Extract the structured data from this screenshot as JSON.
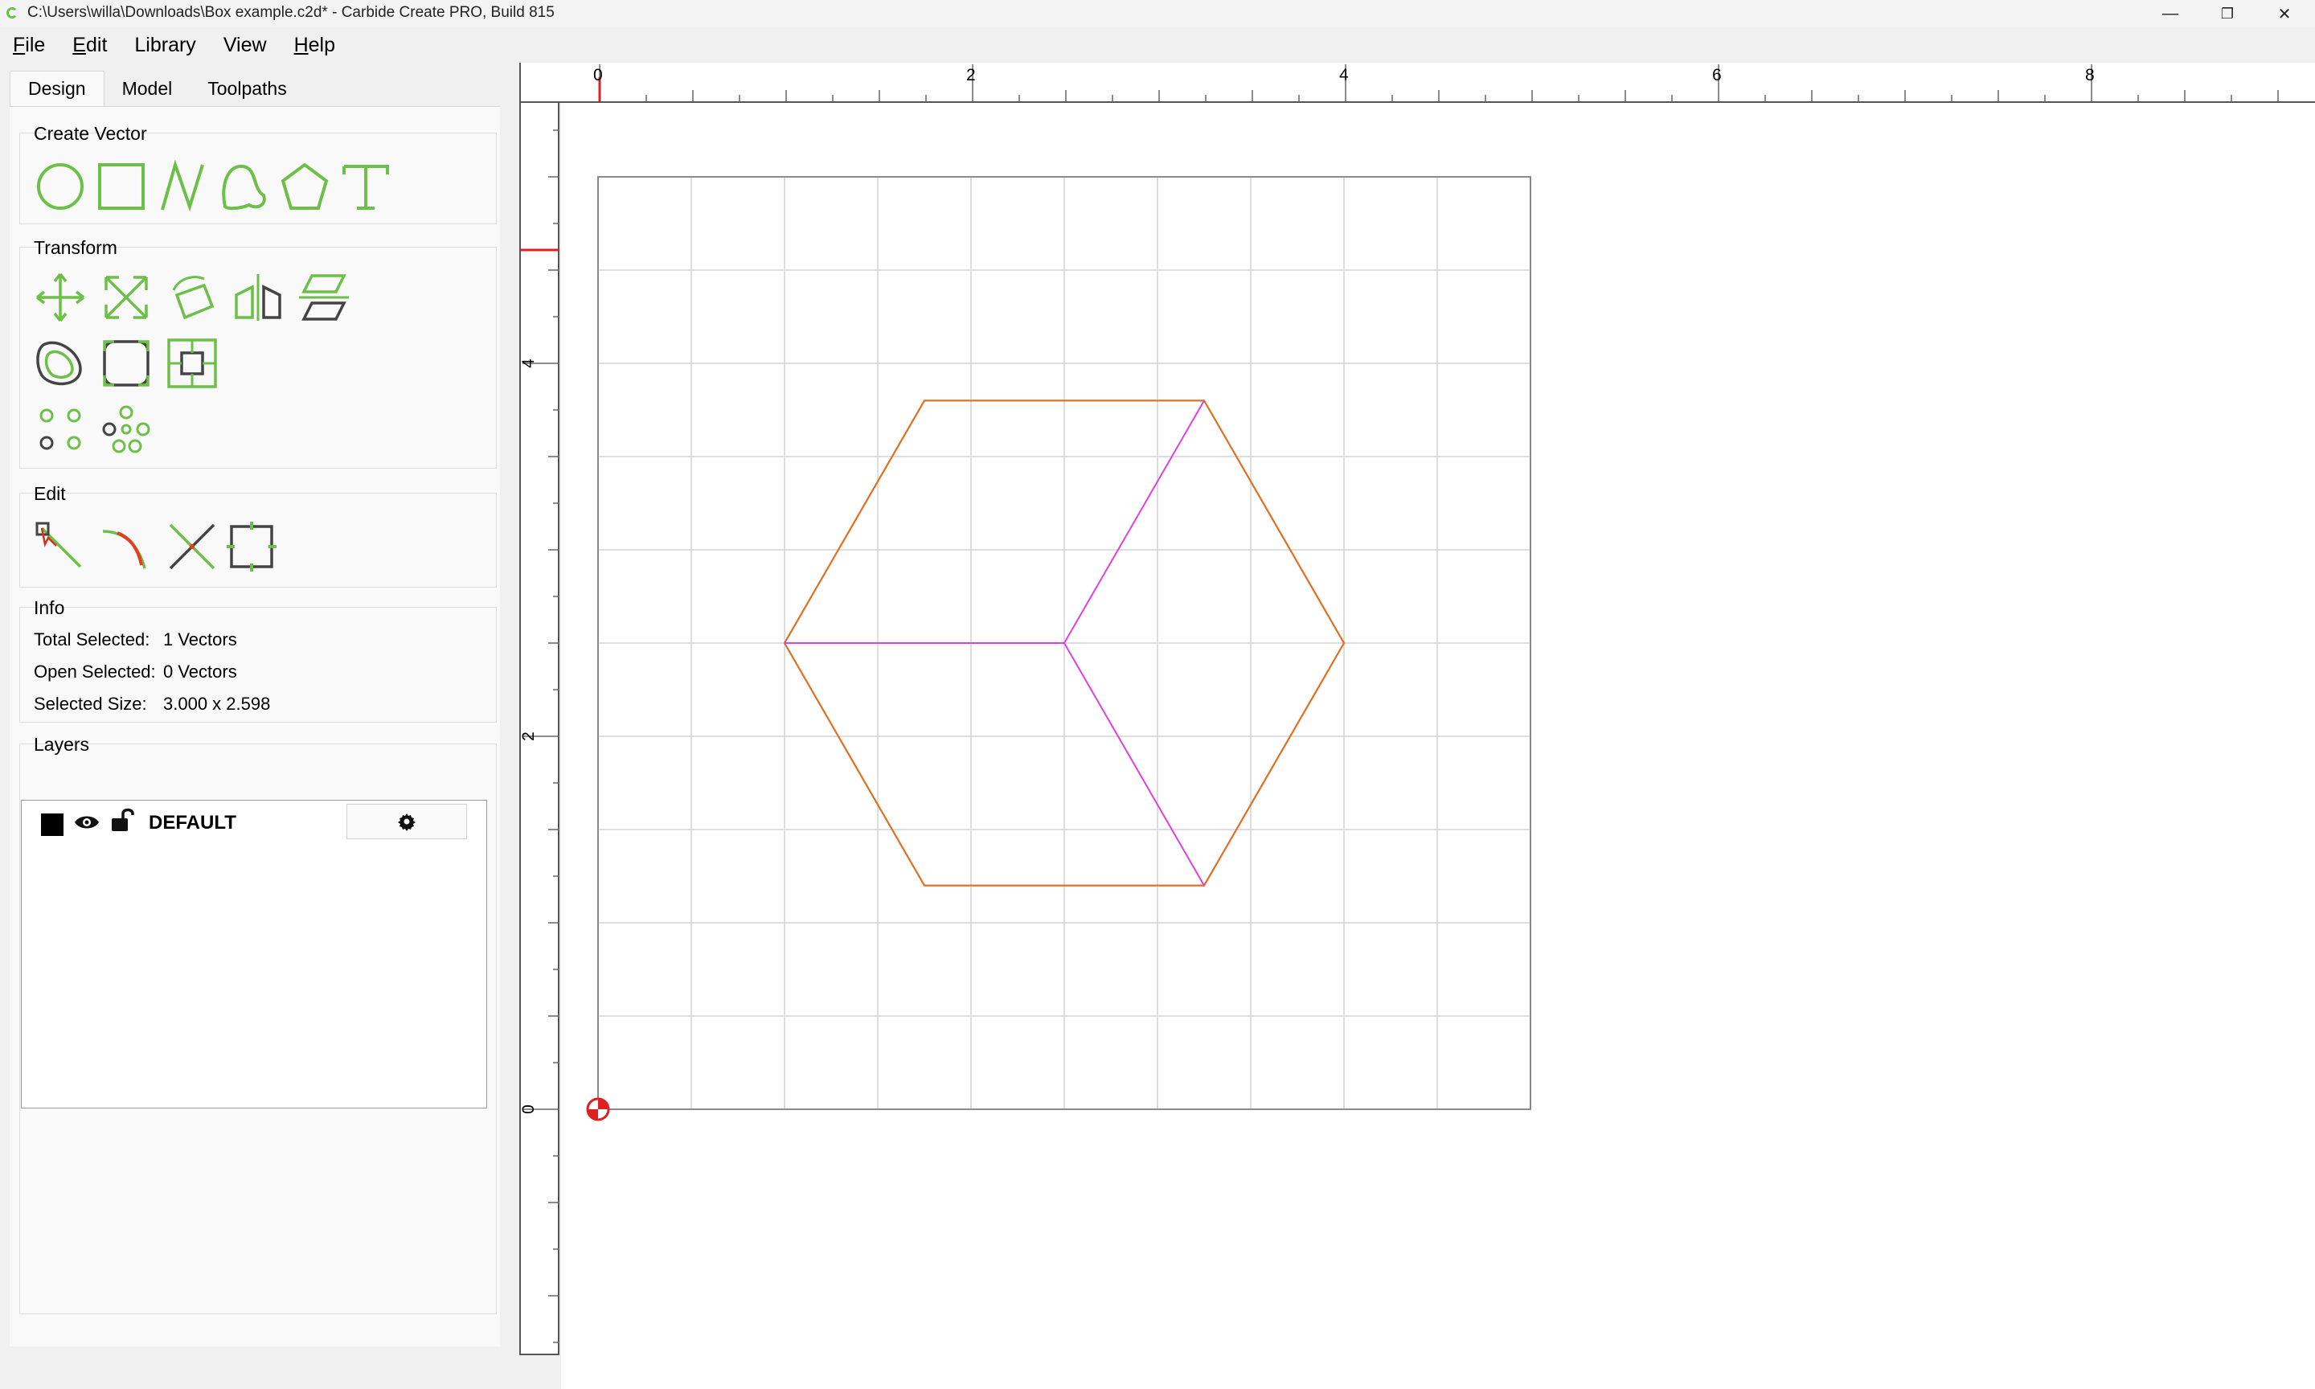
{
  "window": {
    "title": "C:\\Users\\willa\\Downloads\\Box example.c2d* - Carbide Create PRO, Build 815",
    "minimize_glyph": "—",
    "restore_glyph": "❐",
    "close_glyph": "✕"
  },
  "menu": [
    {
      "accel": "F",
      "rest": "ile"
    },
    {
      "accel": "E",
      "rest": "dit"
    },
    {
      "accel": "",
      "rest": "Library"
    },
    {
      "accel": "",
      "rest": "View"
    },
    {
      "accel": "H",
      "rest": "elp"
    }
  ],
  "tabs": [
    "Design",
    "Model",
    "Toolpaths"
  ],
  "active_tab": "Design",
  "sections": {
    "create_vector": "Create Vector",
    "transform": "Transform",
    "edit": "Edit",
    "info": "Info",
    "layers": "Layers"
  },
  "create_vector_tools": [
    "circle-icon",
    "rectangle-icon",
    "polyline-icon",
    "curve-icon",
    "polygon-icon",
    "text-icon"
  ],
  "transform_tools": [
    "move-icon",
    "scale-icon",
    "rotate-icon",
    "mirror-icon",
    "align-icon",
    "offset-icon",
    "fillet-icon",
    "node-edit-icon",
    "array-icon",
    "circular-array-icon"
  ],
  "edit_tools": [
    "node-select-icon",
    "trim-icon",
    "cut-icon",
    "bounding-box-icon"
  ],
  "info": {
    "total_selected_label": "Total Selected:",
    "total_selected_value": "1 Vectors",
    "open_selected_label": "Open Selected:",
    "open_selected_value": "0 Vectors",
    "selected_size_label": "Selected Size:",
    "selected_size_value": "3.000 x 2.598"
  },
  "layers": [
    {
      "name": "DEFAULT",
      "color": "#000000",
      "visible": true,
      "locked": false
    }
  ],
  "ruler": {
    "x_labels": [
      "0",
      "2",
      "4",
      "6",
      "8"
    ],
    "y_labels": [
      "4",
      "2",
      "0"
    ]
  },
  "colors": {
    "accent_green": "#6cbf47",
    "vector_orange": "#e07020",
    "selected_magenta": "#e040e0",
    "grid": "#d4d4d4",
    "marker_red": "#e02020"
  },
  "drawing": {
    "units": "inch",
    "stock_width": 5,
    "stock_height": 5,
    "hexagon": [
      [
        1.75,
        3.8
      ],
      [
        3.25,
        3.8
      ],
      [
        4.0,
        2.5
      ],
      [
        3.25,
        1.2
      ],
      [
        1.75,
        1.2
      ],
      [
        1.0,
        2.5
      ]
    ],
    "inner_lines": [
      [
        [
          1.0,
          2.5
        ],
        [
          2.5,
          2.5
        ]
      ],
      [
        [
          2.5,
          2.5
        ],
        [
          3.25,
          3.8
        ]
      ],
      [
        [
          2.5,
          2.5
        ],
        [
          3.25,
          1.2
        ]
      ]
    ]
  }
}
